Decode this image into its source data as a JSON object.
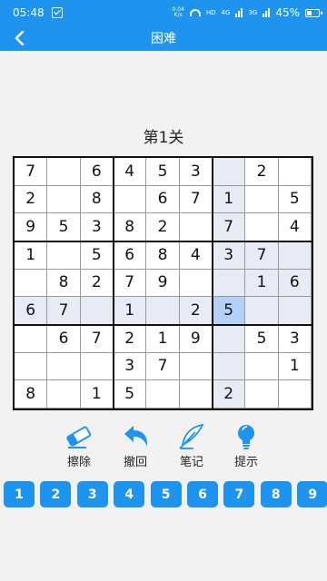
{
  "status": {
    "time": "05:48",
    "net_speed_value": "0.04",
    "net_speed_unit": "K/s",
    "hd": "HD",
    "net_4g": "4G",
    "net_3g": "3G",
    "battery": "45%",
    "battery_level": 0.45
  },
  "header": {
    "title": "困难",
    "back_icon": "chevron-left-icon"
  },
  "level": {
    "title": "第1关"
  },
  "board": {
    "selected": {
      "row": 5,
      "col": 6
    },
    "cells": [
      [
        "7",
        "",
        "6",
        "4",
        "5",
        "3",
        "",
        "2",
        ""
      ],
      [
        "2",
        "",
        "8",
        "",
        "6",
        "7",
        "1",
        "",
        "5"
      ],
      [
        "9",
        "5",
        "3",
        "8",
        "2",
        "",
        "7",
        "",
        "4"
      ],
      [
        "1",
        "",
        "5",
        "6",
        "8",
        "4",
        "3",
        "7",
        ""
      ],
      [
        "",
        "8",
        "2",
        "7",
        "9",
        "",
        "",
        "1",
        "6"
      ],
      [
        "6",
        "7",
        "",
        "1",
        "",
        "2",
        "5",
        "",
        ""
      ],
      [
        "",
        "6",
        "7",
        "2",
        "1",
        "9",
        "",
        "5",
        "3"
      ],
      [
        "",
        "",
        "",
        "3",
        "7",
        "",
        "",
        "",
        "1"
      ],
      [
        "8",
        "",
        "1",
        "5",
        "",
        "",
        "2",
        "",
        ""
      ]
    ]
  },
  "tools": [
    {
      "label": "擦除",
      "icon": "eraser-icon",
      "name": "erase-button"
    },
    {
      "label": "撤回",
      "icon": "undo-icon",
      "name": "undo-button"
    },
    {
      "label": "笔记",
      "icon": "feather-pen-icon",
      "name": "notes-button"
    },
    {
      "label": "提示",
      "icon": "lightbulb-icon",
      "name": "hint-button"
    }
  ],
  "numpad": [
    "1",
    "2",
    "3",
    "4",
    "5",
    "6",
    "7",
    "8",
    "9"
  ],
  "colors": {
    "accent": "#1f94ef",
    "highlight": "#e6ebf5",
    "selected": "#b5d0f7"
  }
}
